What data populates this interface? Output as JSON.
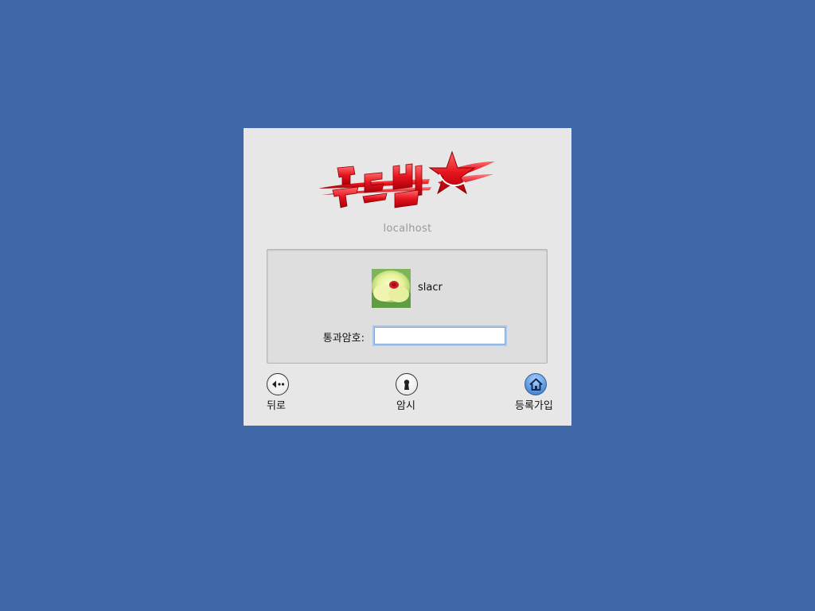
{
  "window": {
    "logo_name": "붉은별",
    "hostname": "localhost"
  },
  "user": {
    "name": "slacr",
    "avatar_icon": "yellow-flower-avatar"
  },
  "password": {
    "label": "통과암호:",
    "value": "",
    "placeholder": ""
  },
  "actions": {
    "back_label": "뒤로",
    "back_icon": "back-arrow-icon",
    "hint_label": "암시",
    "hint_icon": "keyhole-icon",
    "register_label": "등록가입",
    "register_icon": "home-icon"
  },
  "colors": {
    "desktop_background": "#4068a9",
    "window_background": "#e7e7e7",
    "logo_red": "#e5131d",
    "register_blue": "#4f8fdc"
  }
}
